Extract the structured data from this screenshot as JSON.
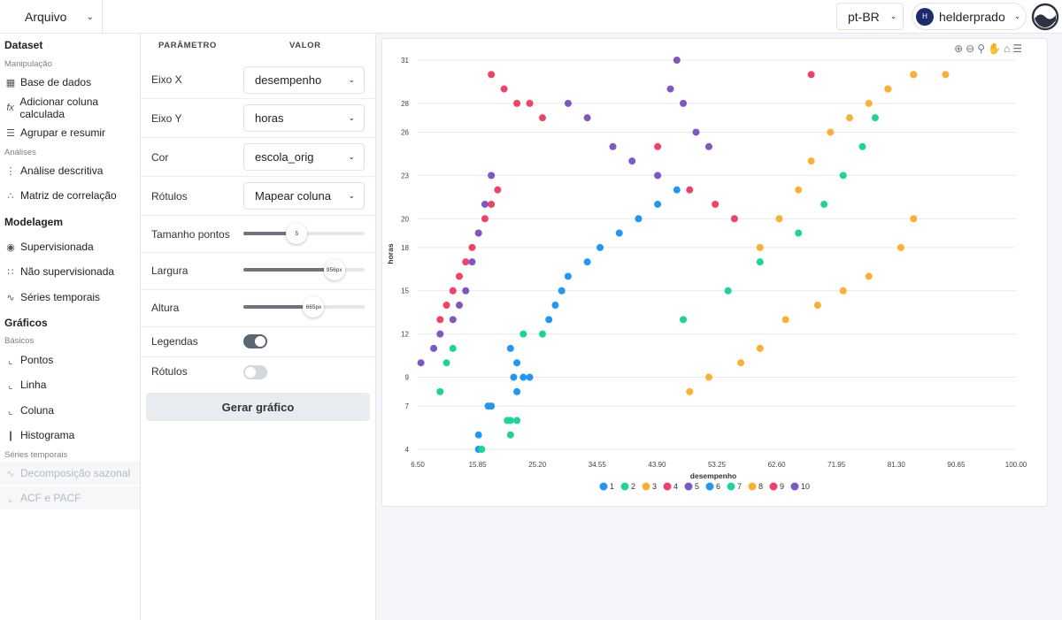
{
  "header": {
    "file_menu": "Arquivo",
    "language": "pt-BR",
    "user_initial": "H",
    "user_name": "helderprado"
  },
  "sidebar": {
    "dataset_title": "Dataset",
    "manip_sub": "Manipulação",
    "base": "Base de dados",
    "calc_col": "Adicionar coluna calculada",
    "group": "Agrupar e resumir",
    "analysis_sub": "Análises",
    "descr": "Análise descritiva",
    "corr": "Matriz de correlação",
    "model_title": "Modelagem",
    "sup": "Supervisionada",
    "unsup": "Não supervisionada",
    "ts": "Séries temporais",
    "graphs_title": "Gráficos",
    "basic_sub": "Básicos",
    "points": "Pontos",
    "line": "Linha",
    "column": "Coluna",
    "histogram": "Histograma",
    "ts_sub": "Séries temporais",
    "seasonal": "Decomposição sazonal",
    "acf": "ACF e PACF"
  },
  "params": {
    "header_param": "PARÂMETRO",
    "header_value": "VALOR",
    "x_label": "Eixo X",
    "x_value": "desempenho",
    "y_label": "Eixo Y",
    "y_value": "horas",
    "color_label": "Cor",
    "color_value": "escola_orig",
    "labels_label": "Rótulos",
    "labels_value": "Mapear coluna",
    "size_label": "Tamanho pontos",
    "size_value": "5",
    "size_fraction": 0.44,
    "width_label": "Largura",
    "width_value": "956px",
    "width_fraction": 0.75,
    "height_label": "Altura",
    "height_value": "665px",
    "height_fraction": 0.58,
    "legends_label": "Legendas",
    "legends_on": true,
    "rotulos_label": "Rótulos",
    "rotulos_on": false,
    "generate": "Gerar gráfico"
  },
  "colors": {
    "1": "#2196f3",
    "2": "#1ed39a",
    "3": "#fbb034",
    "4": "#ef4266",
    "5": "#7e57c2",
    "6": "#2196f3",
    "7": "#1ed39a",
    "8": "#fbb034",
    "9": "#ef4266",
    "10": "#7e57c2"
  },
  "chart_data": {
    "type": "scatter",
    "xlabel": "desempenho",
    "ylabel": "horas",
    "xticks": [
      "6.50",
      "15.85",
      "25.20",
      "34.55",
      "43.90",
      "53.25",
      "62.60",
      "71.95",
      "81.30",
      "90.65",
      "100.00"
    ],
    "yticks": [
      "4",
      "7",
      "9",
      "12",
      "15",
      "18",
      "20",
      "23",
      "26",
      "28",
      "31"
    ],
    "xlim": [
      6.5,
      100.0
    ],
    "ylim": [
      4,
      31
    ],
    "grid": true,
    "legend_position": "bottom",
    "series": [
      {
        "name": "1",
        "points": [
          [
            21.5,
            9
          ],
          [
            22,
            8
          ],
          [
            17.5,
            7
          ],
          [
            18,
            7
          ],
          [
            16,
            4
          ],
          [
            16,
            5
          ],
          [
            21,
            11
          ],
          [
            22,
            10
          ],
          [
            23,
            9
          ],
          [
            24,
            9
          ]
        ]
      },
      {
        "name": "2",
        "points": [
          [
            16.5,
            4
          ],
          [
            20.5,
            6
          ],
          [
            21,
            6
          ],
          [
            22,
            6
          ],
          [
            21,
            5
          ],
          [
            10,
            8
          ],
          [
            11,
            10
          ],
          [
            12,
            11
          ],
          [
            23,
            12
          ],
          [
            26,
            12
          ]
        ]
      },
      {
        "name": "3",
        "points": [
          [
            49,
            8
          ],
          [
            52,
            9
          ],
          [
            57,
            10
          ],
          [
            60,
            11
          ],
          [
            64,
            13
          ],
          [
            69,
            14
          ],
          [
            73,
            15
          ],
          [
            77,
            16
          ],
          [
            82,
            18
          ],
          [
            84,
            20
          ]
        ]
      },
      {
        "name": "4",
        "points": [
          [
            10,
            13
          ],
          [
            11,
            14
          ],
          [
            12,
            15
          ],
          [
            13,
            16
          ],
          [
            14,
            17
          ],
          [
            15,
            18
          ],
          [
            16,
            19
          ],
          [
            17,
            20
          ],
          [
            18,
            21
          ],
          [
            19,
            22
          ]
        ]
      },
      {
        "name": "5",
        "points": [
          [
            7,
            10
          ],
          [
            9,
            11
          ],
          [
            10,
            12
          ],
          [
            12,
            13
          ],
          [
            13,
            14
          ],
          [
            14,
            15
          ],
          [
            15,
            17
          ],
          [
            16,
            19
          ],
          [
            17,
            21
          ],
          [
            18,
            23
          ]
        ]
      },
      {
        "name": "6",
        "points": [
          [
            27,
            13
          ],
          [
            28,
            14
          ],
          [
            29,
            15
          ],
          [
            30,
            16
          ],
          [
            33,
            17
          ],
          [
            35,
            18
          ],
          [
            38,
            19
          ],
          [
            41,
            20
          ],
          [
            44,
            21
          ],
          [
            47,
            22
          ]
        ]
      },
      {
        "name": "7",
        "points": [
          [
            48,
            13
          ],
          [
            55,
            15
          ],
          [
            60,
            17
          ],
          [
            66,
            19
          ],
          [
            70,
            21
          ],
          [
            73,
            23
          ],
          [
            76,
            25
          ],
          [
            78,
            27
          ],
          [
            80,
            29
          ],
          [
            84,
            30
          ]
        ]
      },
      {
        "name": "8",
        "points": [
          [
            60,
            18
          ],
          [
            63,
            20
          ],
          [
            66,
            22
          ],
          [
            68,
            24
          ],
          [
            71,
            26
          ],
          [
            74,
            27
          ],
          [
            77,
            28
          ],
          [
            80,
            29
          ],
          [
            84,
            30
          ],
          [
            89,
            30
          ]
        ]
      },
      {
        "name": "9",
        "points": [
          [
            18,
            30
          ],
          [
            20,
            29
          ],
          [
            22,
            28
          ],
          [
            24,
            28
          ],
          [
            26,
            27
          ],
          [
            44,
            25
          ],
          [
            49,
            22
          ],
          [
            53,
            21
          ],
          [
            56,
            20
          ],
          [
            68,
            30
          ]
        ]
      },
      {
        "name": "10",
        "points": [
          [
            30,
            28
          ],
          [
            33,
            27
          ],
          [
            37,
            25
          ],
          [
            40,
            24
          ],
          [
            44,
            23
          ],
          [
            46,
            29
          ],
          [
            47,
            31
          ],
          [
            48,
            28
          ],
          [
            50,
            26
          ],
          [
            52,
            25
          ]
        ]
      }
    ]
  }
}
